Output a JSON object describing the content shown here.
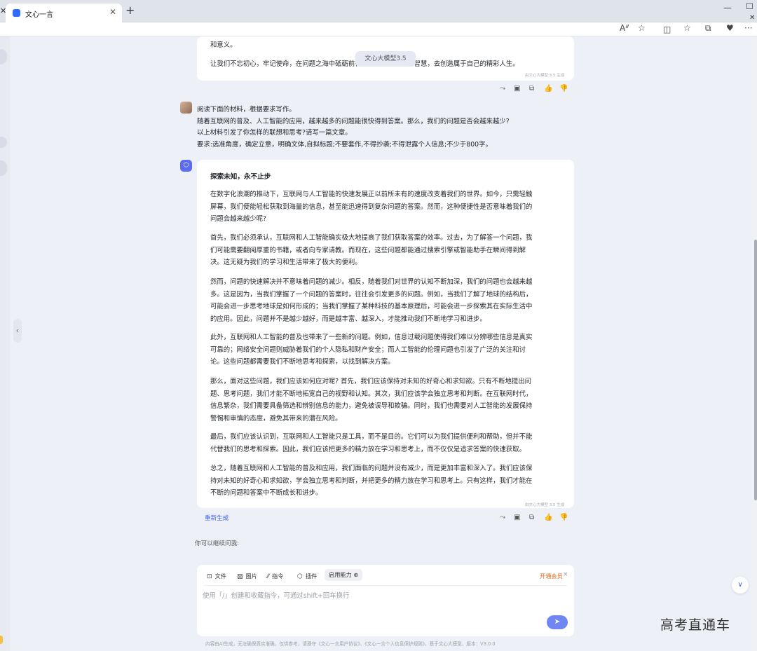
{
  "browser": {
    "tab_title": "文心一言",
    "tab_close": "✕",
    "new_tab": "+",
    "left_close": "✕",
    "win_min": "—",
    "win_max": "☐",
    "win_close": "✕",
    "toolbar_icons": [
      "Aᐥ",
      "☆",
      "◫",
      "☆",
      "⧉",
      "♥",
      "···"
    ]
  },
  "previous_answer": {
    "lines": [
      "和意义。",
      "让我们不忘初心，牢记使命，在问题之海中砥砺前行。让我们用勇气和智慧，去创造属于自己的精彩人生。"
    ],
    "model_pill": "文心大模型3.5",
    "gen_note": "由文心大模型 3.5 生成"
  },
  "action_icons": [
    "⤳",
    "▣",
    "⧉",
    "👍",
    "👎"
  ],
  "user_message": {
    "lines": [
      "阅读下面的材料，根据要求写作。",
      "随着互联网的普及、人工智能的应用，越来越多的问题能很快得到答案。那么，我们的问题是否会越来越少?",
      "以上材料引发了你怎样的联想和思考?请写一篇文章。",
      "要求:选准角度，确定立意，明确文体,自拟标题;不要套作,不得抄袭;不得泄露个人信息;不少于800字。"
    ]
  },
  "essay": {
    "title": "探索未知，永不止步",
    "paragraphs": [
      [
        "在数字化浪潮的推动下，互联网与人工智能的快速发展正以前所未有的速度改变着我们的世界。如今，只需轻触",
        "屏幕，我们便能轻松获取到海量的信息，甚至能迅速得到复杂问题的答案。然而，这种便捷性是否意味着我们的",
        "问题会越来越少呢?"
      ],
      [
        "首先，我们必须承认，互联网和人工智能确实极大地提高了我们获取答案的效率。过去，为了解答一个问题，我",
        "们可能需要翻阅厚重的书籍，或者向专家请教。而现在，这些问题都能通过搜索引擎或智能助手在瞬间得到解",
        "决。这无疑为我们的学习和生活带来了极大的便利。"
      ],
      [
        "然而，问题的快速解决并不意味着问题的减少。相反，随着我们对世界的认知不断加深，我们的问题也会越来越",
        "多。这是因为，当我们掌握了一个问题的答案时，往往会引发更多的问题。例如，当我们了解了地球的结构后，",
        "可能会进一步思考地球是如何形成的；当我们掌握了某种科技的基本原理后，可能会进一步探索其在实际生活中",
        "的应用。因此，问题并不是越少越好，而是越丰富、越深入，才能推动我们不断地学习和进步。"
      ],
      [
        "此外，互联网和人工智能的普及也带来了一些新的问题。例如，信息过载问题使得我们难以分辨哪些信息是真实",
        "可靠的；网络安全问题则威胁着我们的个人隐私和财产安全；而人工智能的伦理问题也引发了广泛的关注和讨",
        "论。这些问题都需要我们不断地思考和探索，以找到解决方案。"
      ],
      [
        "那么，面对这些问题，我们应该如何应对呢? 首先，我们应该保持对未知的好奇心和求知欲。只有不断地提出问",
        "题、思考问题，我们才能不断地拓宽自己的视野和认知。其次，我们应该学会独立思考和判断。在互联网时代，",
        "信息繁杂，我们需要具备筛选和辨别信息的能力，避免被误导和欺骗。同时，我们也需要对人工智能的发展保持",
        "警惕和审慎的态度，避免其带来的潜在风险。"
      ],
      [
        "最后，我们应该认识到，互联网和人工智能只是工具，而不是目的。它们可以为我们提供便利和帮助，但并不能",
        "代替我们的思考和探索。因此，我们应该把更多的精力放在学习和思考上，而不仅仅是追求答案的快速获取。"
      ],
      [
        "总之，随着互联网和人工智能的普及和应用，我们面临的问题并没有减少，而是更加丰富和深入了。我们应该保",
        "持对未知的好奇心和求知欲，学会独立思考和判断，并把更多的精力放在学习和思考上。只有这样，我们才能在",
        "不断的问题和答案中不断成长和进步。"
      ]
    ],
    "gen_note": "由文心大模型 3.5 生成"
  },
  "regenerate_label": "重新生成",
  "continue_label": "你可以继续问我:",
  "input": {
    "tools": [
      {
        "icon": "⊡",
        "label": "文件"
      },
      {
        "icon": "▨",
        "label": "图片"
      },
      {
        "icon": "⁄⁄",
        "label": "指令"
      },
      {
        "icon": "⬡",
        "label": "插件"
      }
    ],
    "abilities_label": "启用能力 ⊕",
    "vip_label": "开通会员",
    "vip_close": "×",
    "placeholder": "使用「/」创建和收藏指令，可通过shift+回车换行",
    "send_icon": "➤"
  },
  "footer_note": "内容由AI生成，无法确保真实准确，仅供参考，请遵守《文心一言用户协议》、《文心一言个人信息保护规则》，基于文心大模型，版本：V3.0.0",
  "scroll_down_icon": "∨",
  "collapse_icon": "‹",
  "watermark": "高考直通车"
}
